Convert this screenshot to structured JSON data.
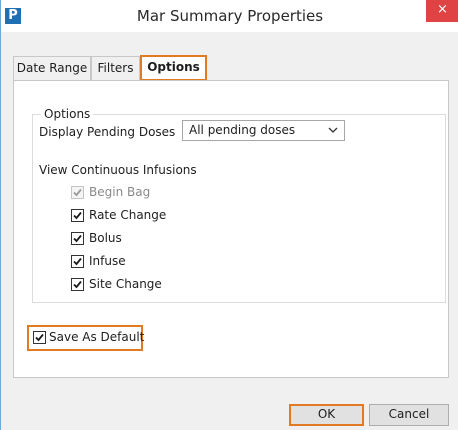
{
  "window": {
    "title": "Mar Summary Properties",
    "app_icon_glyph": "P",
    "close_glyph": "×"
  },
  "tabs": [
    {
      "label": "Date Range",
      "active": false
    },
    {
      "label": "Filters",
      "active": false
    },
    {
      "label": "Options",
      "active": true
    }
  ],
  "options_group": {
    "legend": "Options",
    "pending_doses_label": "Display Pending Doses",
    "pending_doses_value": "All pending doses",
    "continuous_infusions_label": "View Continuous Infusions",
    "checkboxes": [
      {
        "label": "Begin Bag",
        "checked": true,
        "disabled": true
      },
      {
        "label": "Rate Change",
        "checked": true,
        "disabled": false
      },
      {
        "label": "Bolus",
        "checked": true,
        "disabled": false
      },
      {
        "label": "Infuse",
        "checked": true,
        "disabled": false
      },
      {
        "label": "Site Change",
        "checked": true,
        "disabled": false
      }
    ]
  },
  "save_default": {
    "label": "Save As Default",
    "checked": true
  },
  "buttons": {
    "ok": "OK",
    "cancel": "Cancel"
  },
  "colors": {
    "highlight": "#e07b24",
    "close_button": "#e04343",
    "app_icon": "#1f6fb5"
  }
}
